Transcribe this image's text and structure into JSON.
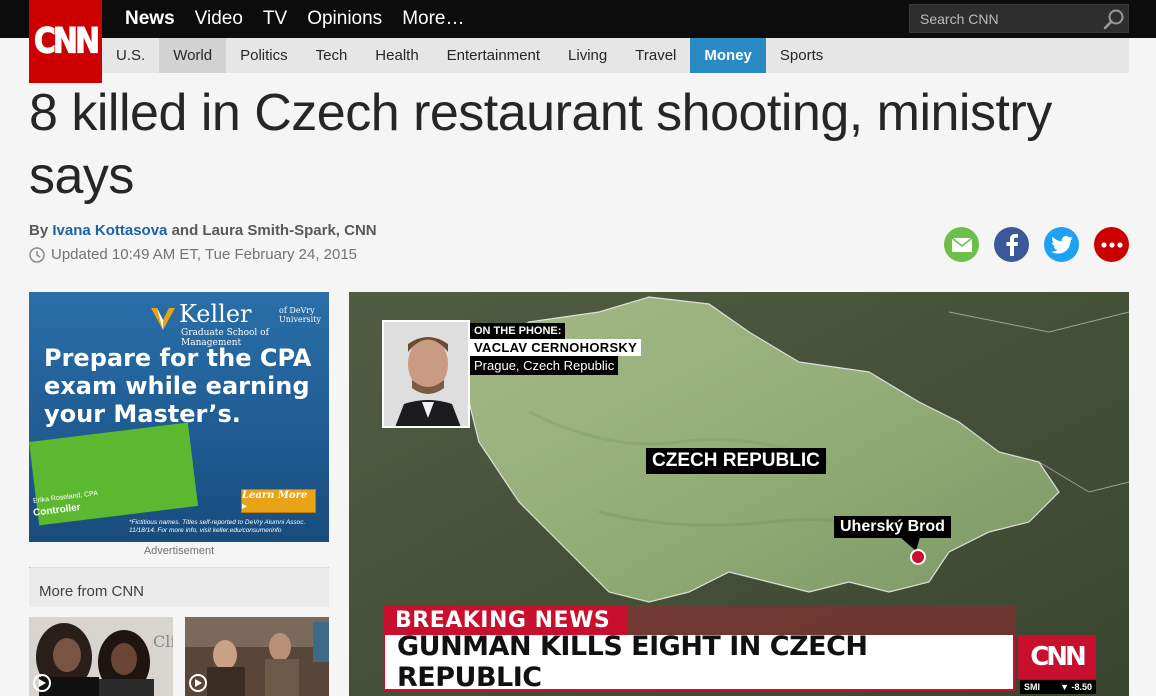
{
  "header": {
    "logo_text": "CNN",
    "nav": [
      "News",
      "Video",
      "TV",
      "Opinions",
      "More…"
    ],
    "search_placeholder": "Search CNN"
  },
  "subnav": [
    "U.S.",
    "World",
    "Politics",
    "Tech",
    "Health",
    "Entertainment",
    "Living",
    "Travel",
    "Money",
    "Sports"
  ],
  "article": {
    "headline": "8 killed in Czech restaurant shooting, ministry says",
    "by_prefix": "By",
    "author1": "Ivana Kottasova",
    "author_sep": "and Laura Smith-Spark, CNN",
    "updated": "Updated 10:49 AM ET, Tue February 24, 2015"
  },
  "share_icons": [
    "email-icon",
    "facebook-icon",
    "twitter-icon",
    "more-icon"
  ],
  "colors": {
    "cnn_red": "#cc0000",
    "money_blue": "#2b8ac4",
    "facebook": "#3b5998",
    "twitter": "#1da1f2",
    "email": "#6cc04a",
    "more": "#cc0000"
  },
  "ad": {
    "brand": "Keller",
    "brand_sub": "Graduate School of Management",
    "devry": "of DeVry University",
    "headline": "Prepare for the CPA exam while earning your Master’s.",
    "card_name": "Erika Roseland, CPA",
    "card_title": "Controller",
    "button": "Learn More ▸",
    "fine_print": "*Fictitious names. Titles self-reported to DeVry Alumni Assoc. 11/18/14. For more info, visit keller.edu/consumerinfo",
    "label": "Advertisement"
  },
  "more_from": {
    "title": "More from CNN"
  },
  "video": {
    "phone_label": "ON THE PHONE:",
    "caller_name": "VACLAV CERNOHORSKY",
    "caller_location": "Prague, Czech Republic",
    "country_label": "CZECH REPUBLIC",
    "city_label": "Uherský Brod",
    "breaking": "BREAKING NEWS",
    "ticker": "GUNMAN KILLS EIGHT IN CZECH REPUBLIC",
    "logo": "CNN",
    "smi_label": "SMI",
    "smi_value": "▼  -8.50"
  }
}
